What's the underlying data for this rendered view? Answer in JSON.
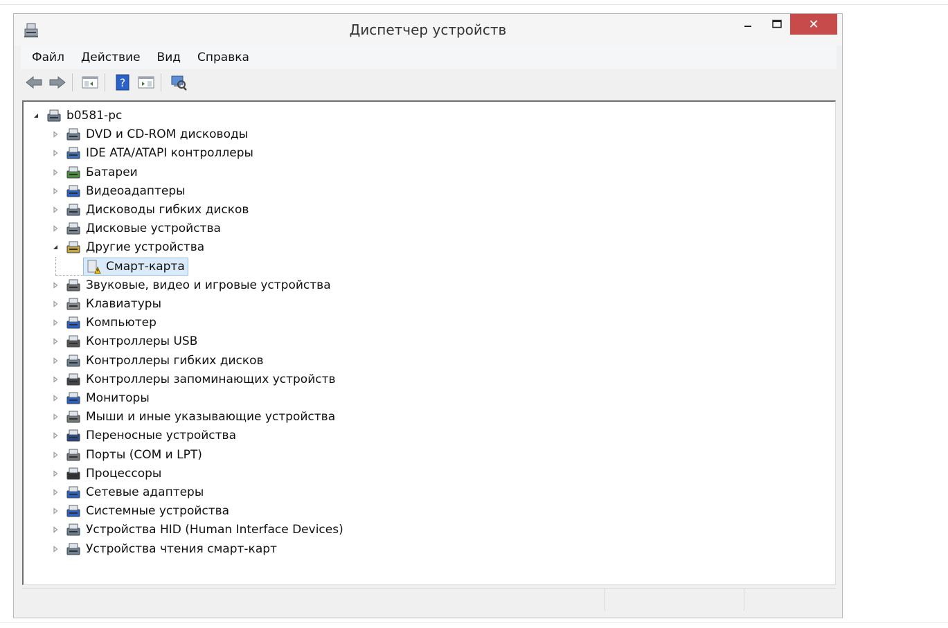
{
  "window": {
    "title": "Диспетчер устройств",
    "close_glyph": "✕",
    "accent_close": "#c74b4b"
  },
  "menu": {
    "items": [
      "Файл",
      "Действие",
      "Вид",
      "Справка"
    ]
  },
  "toolbar": {
    "icons": [
      "back-arrow-icon",
      "forward-arrow-icon",
      "properties-pane-icon",
      "help-icon",
      "action-pane-icon",
      "scan-hardware-icon"
    ]
  },
  "tree": {
    "root": "b0581-pc",
    "categories": [
      {
        "label": "DVD и CD-ROM дисководы",
        "icon": "dvd-drive-icon"
      },
      {
        "label": "IDE ATA/ATAPI контроллеры",
        "icon": "ide-controller-icon"
      },
      {
        "label": "Батареи",
        "icon": "battery-icon"
      },
      {
        "label": "Видеоадаптеры",
        "icon": "display-adapter-icon"
      },
      {
        "label": "Дисководы гибких дисков",
        "icon": "floppy-drive-icon"
      },
      {
        "label": "Дисковые устройства",
        "icon": "disk-drive-icon"
      },
      {
        "label": "Другие устройства",
        "icon": "unknown-device-icon",
        "expanded": true,
        "children": [
          {
            "label": "Смарт-карта",
            "icon": "warning-device-icon",
            "selected": true
          }
        ]
      },
      {
        "label": "Звуковые, видео и игровые устройства",
        "icon": "speaker-icon"
      },
      {
        "label": "Клавиатуры",
        "icon": "keyboard-icon"
      },
      {
        "label": "Компьютер",
        "icon": "computer-icon"
      },
      {
        "label": "Контроллеры USB",
        "icon": "usb-icon"
      },
      {
        "label": "Контроллеры гибких дисков",
        "icon": "floppy-controller-icon"
      },
      {
        "label": "Контроллеры запоминающих устройств",
        "icon": "storage-controller-icon"
      },
      {
        "label": "Мониторы",
        "icon": "monitor-icon"
      },
      {
        "label": "Мыши и иные указывающие устройства",
        "icon": "mouse-icon"
      },
      {
        "label": "Переносные устройства",
        "icon": "portable-device-icon"
      },
      {
        "label": "Порты (COM и LPT)",
        "icon": "port-icon"
      },
      {
        "label": "Процессоры",
        "icon": "processor-icon"
      },
      {
        "label": "Сетевые адаптеры",
        "icon": "network-adapter-icon"
      },
      {
        "label": "Системные устройства",
        "icon": "system-device-icon"
      },
      {
        "label": "Устройства HID (Human Interface Devices)",
        "icon": "hid-icon"
      },
      {
        "label": "Устройства чтения смарт-карт",
        "icon": "smartcard-reader-icon"
      }
    ]
  }
}
